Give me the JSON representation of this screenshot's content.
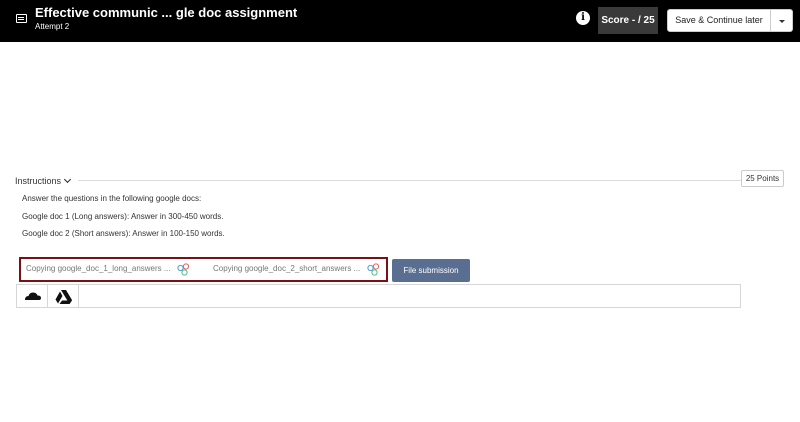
{
  "header": {
    "title": "Effective communic ... gle doc assignment",
    "subtitle": "Attempt 2",
    "info_glyph": "i",
    "score_label": "Score - / 25",
    "save_label": "Save & Continue later"
  },
  "instructions": {
    "label": "Instructions",
    "points": "25 Points",
    "lines": [
      "Answer the questions in the following google docs:",
      "Google doc 1 (Long answers): Answer in 300-450 words.",
      "Google doc 2 (Short answers): Answer in 100-150 words."
    ]
  },
  "files": [
    {
      "name": "Copying google_doc_1_long_answers ...",
      "icon": "google-docs-status-icon"
    },
    {
      "name": "Copying google_doc_2_short_answers ...",
      "icon": "google-docs-status-icon"
    }
  ],
  "file_submission_label": "File submission",
  "upload_sources": [
    {
      "icon": "onedrive-icon"
    },
    {
      "icon": "google-drive-icon"
    }
  ],
  "colors": {
    "header_bg": "#000000",
    "score_bg": "#3a3a3a",
    "highlight_border": "#7a0f14",
    "submit_button": "#5a6e91"
  }
}
